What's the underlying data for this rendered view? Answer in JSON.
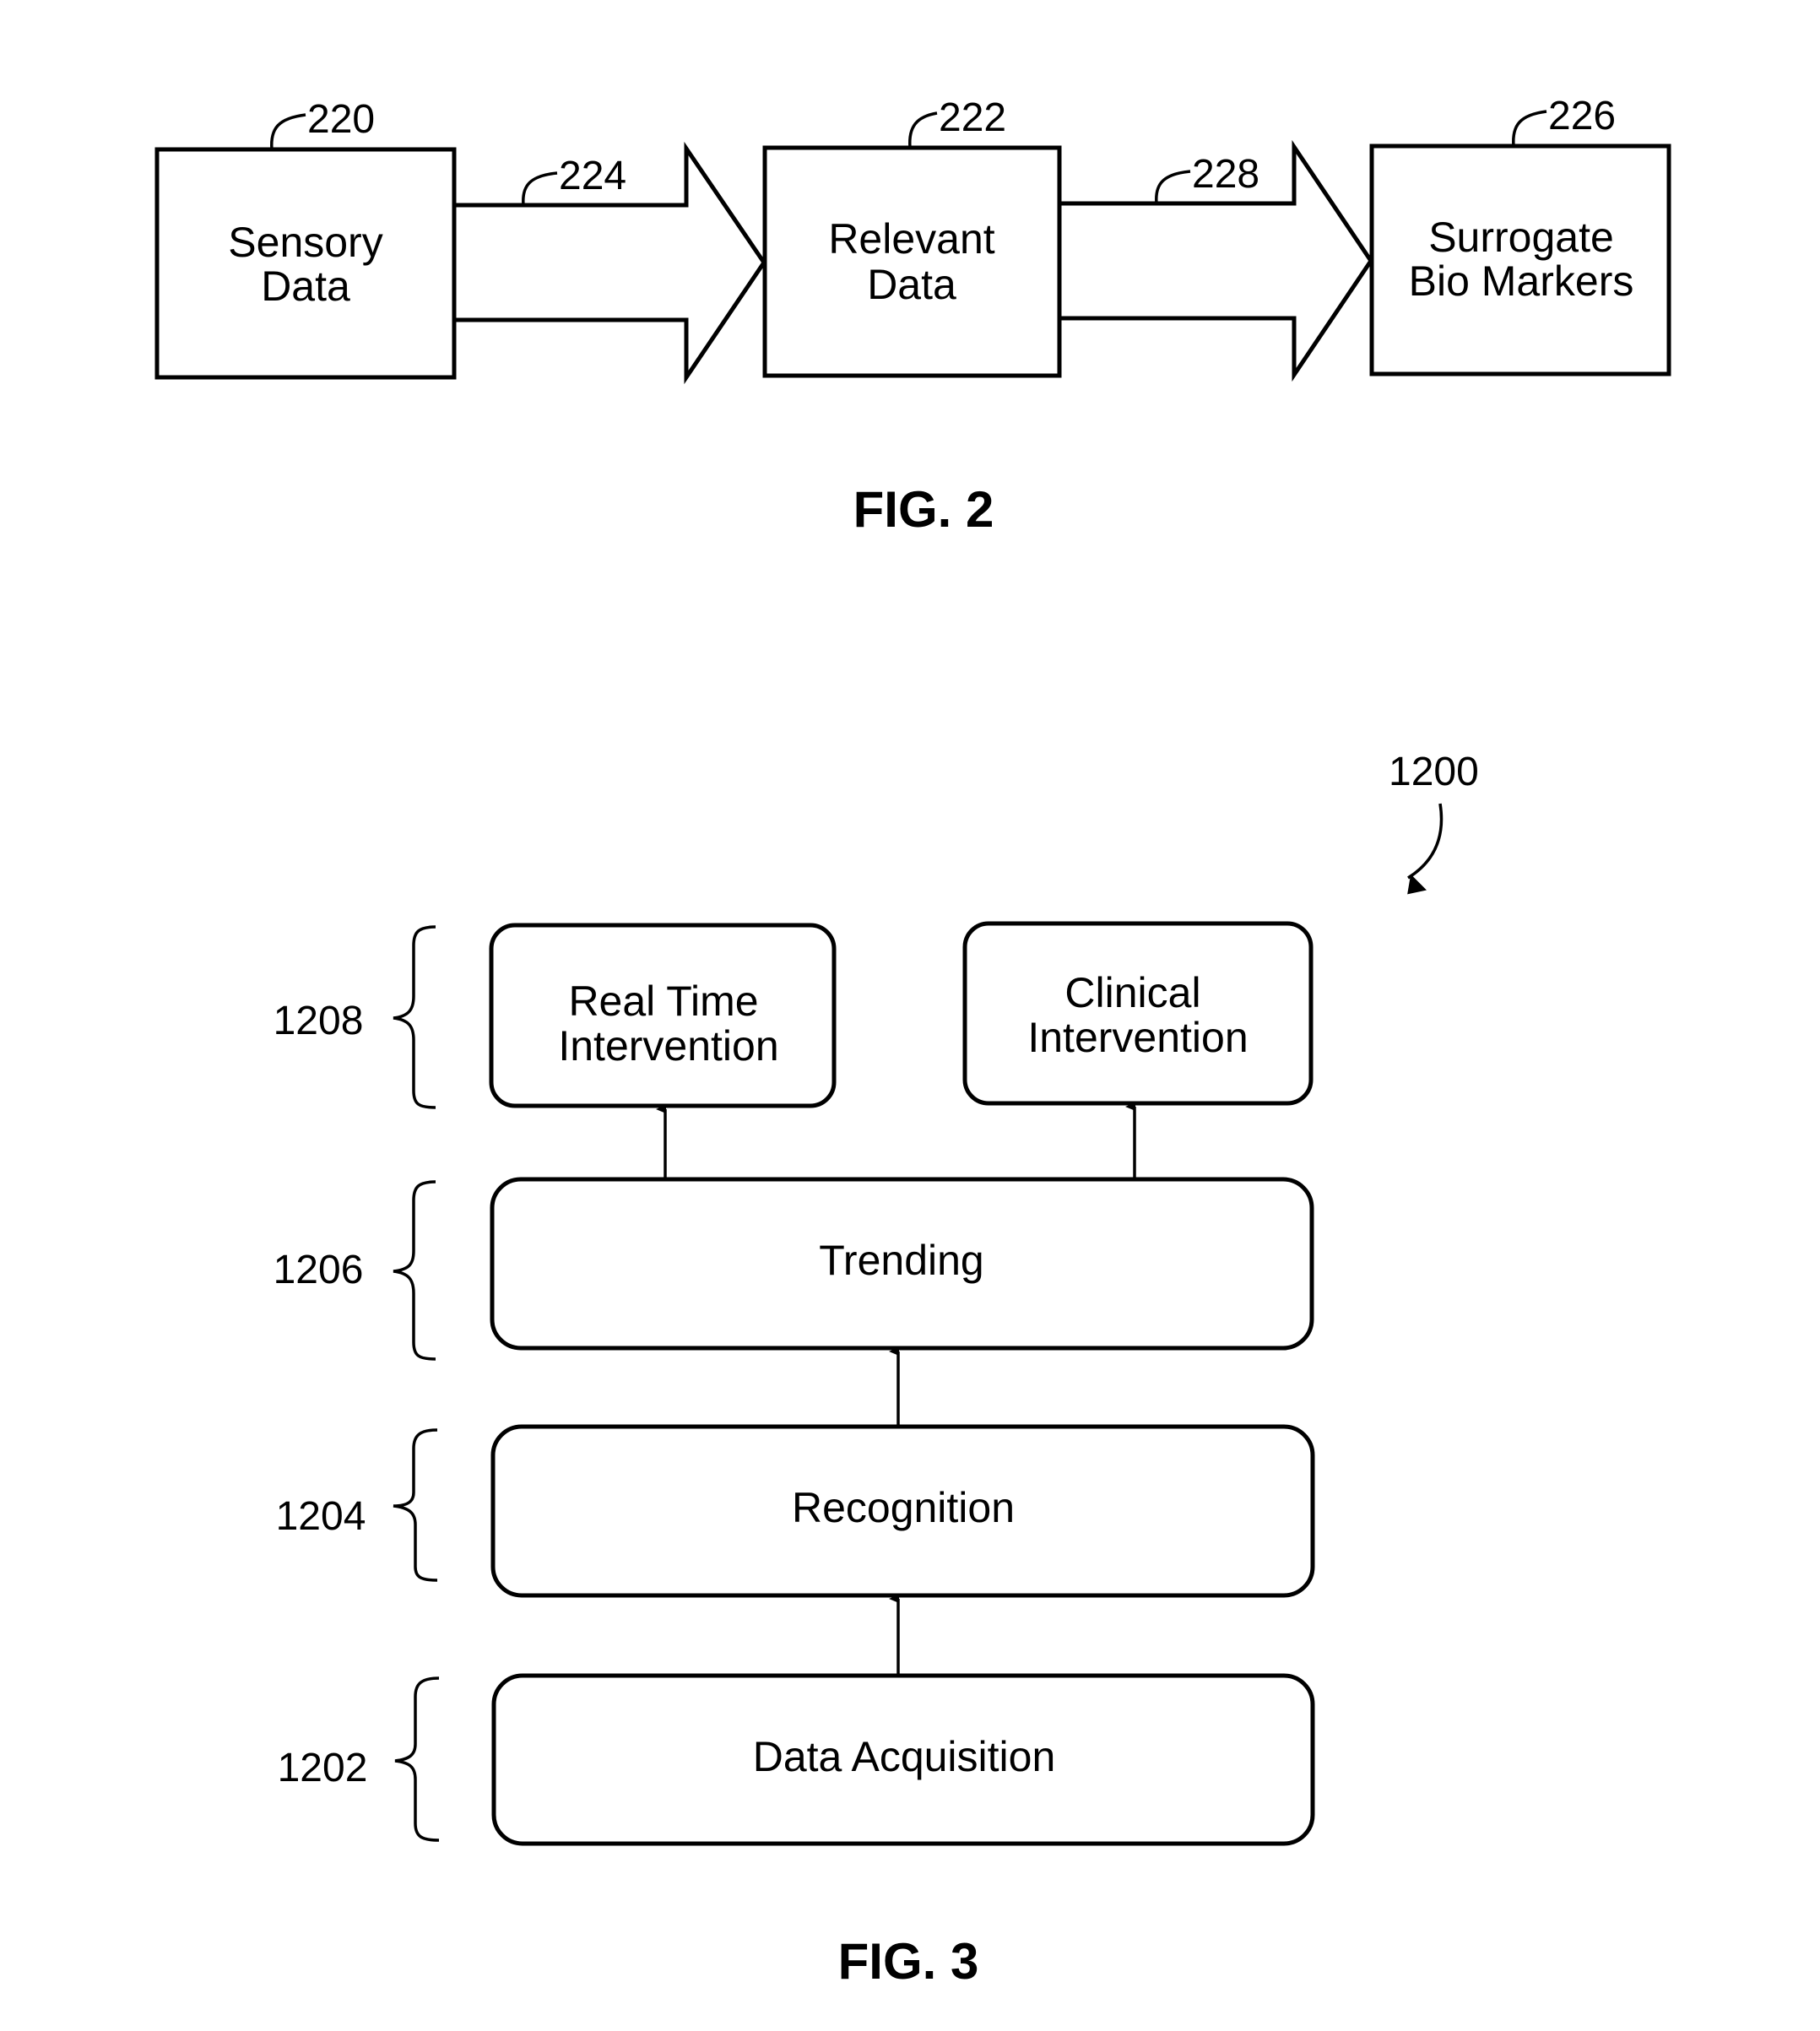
{
  "fig2": {
    "caption": "FIG. 2",
    "boxes": [
      {
        "ref": "220",
        "lines": [
          "Sensory",
          "Data"
        ]
      },
      {
        "ref": "222",
        "lines": [
          "Relevant",
          "Data"
        ]
      },
      {
        "ref": "226",
        "lines": [
          "Surrogate",
          "Bio Markers"
        ]
      }
    ],
    "arrows": [
      {
        "ref": "224",
        "from": "Sensory Data",
        "to": "Relevant Data"
      },
      {
        "ref": "228",
        "from": "Relevant Data",
        "to": "Surrogate Bio Markers"
      }
    ]
  },
  "fig3": {
    "caption": "FIG. 3",
    "ref": "1200",
    "layers": [
      {
        "ref": "1208",
        "boxes": [
          {
            "lines": [
              "Real Time",
              "Intervention"
            ]
          },
          {
            "lines": [
              "Clinical",
              "Intervention"
            ]
          }
        ]
      },
      {
        "ref": "1206",
        "boxes": [
          {
            "lines": [
              "Trending"
            ]
          }
        ]
      },
      {
        "ref": "1204",
        "boxes": [
          {
            "lines": [
              "Recognition"
            ]
          }
        ]
      },
      {
        "ref": "1202",
        "boxes": [
          {
            "lines": [
              "Data Acquisition"
            ]
          }
        ]
      }
    ]
  }
}
